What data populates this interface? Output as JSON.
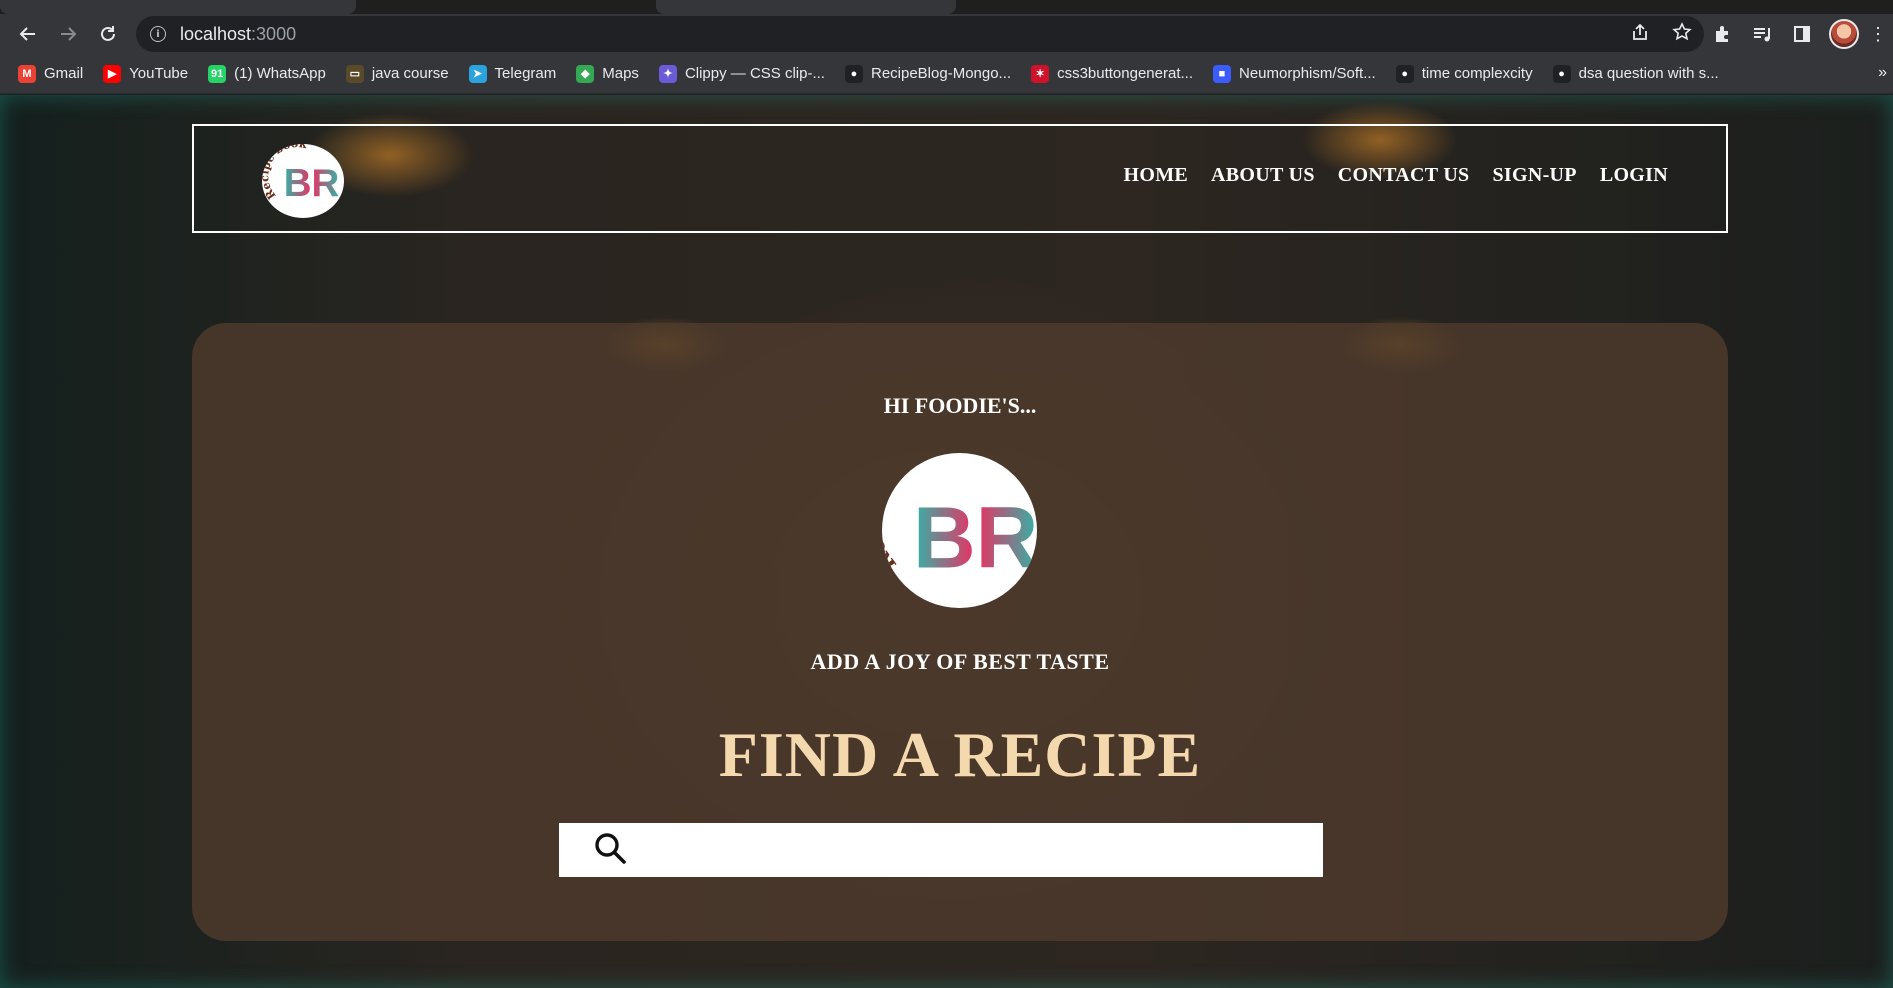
{
  "browser": {
    "url_host": "localhost",
    "url_port": ":3000",
    "bookmarks": [
      {
        "label": "Gmail",
        "icon": "gmail-icon",
        "color": "#ea4335",
        "glyph": "M"
      },
      {
        "label": "YouTube",
        "icon": "youtube-icon",
        "color": "#ff0000",
        "glyph": "▶"
      },
      {
        "label": "(1) WhatsApp",
        "icon": "whatsapp-icon",
        "color": "#25d366",
        "glyph": "91"
      },
      {
        "label": "java course",
        "icon": "course-icon",
        "color": "#5a4a2a",
        "glyph": "▭"
      },
      {
        "label": "Telegram",
        "icon": "telegram-icon",
        "color": "#2aa3df",
        "glyph": "➤"
      },
      {
        "label": "Maps",
        "icon": "maps-icon",
        "color": "#34a853",
        "glyph": "◆"
      },
      {
        "label": "Clippy — CSS clip-...",
        "icon": "clippy-icon",
        "color": "#6b5bd6",
        "glyph": "✦"
      },
      {
        "label": "RecipeBlog-Mongo...",
        "icon": "github-icon",
        "color": "#202124",
        "glyph": "●"
      },
      {
        "label": "css3buttongenerat...",
        "icon": "star-burst-icon",
        "color": "#d0112b",
        "glyph": "✶"
      },
      {
        "label": "Neumorphism/Soft...",
        "icon": "neumorphism-icon",
        "color": "#3b5cff",
        "glyph": "■"
      },
      {
        "label": "time complexcity",
        "icon": "github-icon",
        "color": "#202124",
        "glyph": "●"
      },
      {
        "label": "dsa question with s...",
        "icon": "github-icon",
        "color": "#202124",
        "glyph": "●"
      }
    ],
    "more_glyph": "»"
  },
  "nav": {
    "links": [
      "HOME",
      "ABOUT US",
      "CONTACT US",
      "SIGN-UP",
      "LOGIN"
    ]
  },
  "hero": {
    "greeting": "HI FOODIE'S...",
    "tagline": "ADD A JOY OF BEST TASTE",
    "heading": "FIND A RECIPE",
    "search_placeholder": ""
  },
  "logo": {
    "ring_text": "Recipe book",
    "monogram": "BR"
  },
  "colors": {
    "heading": "#f5d9ae",
    "card": "#4e3a2c",
    "logo_teal": "#2fb5a8",
    "logo_pink": "#ec2f62",
    "logo_brown": "#6b2a1a"
  }
}
